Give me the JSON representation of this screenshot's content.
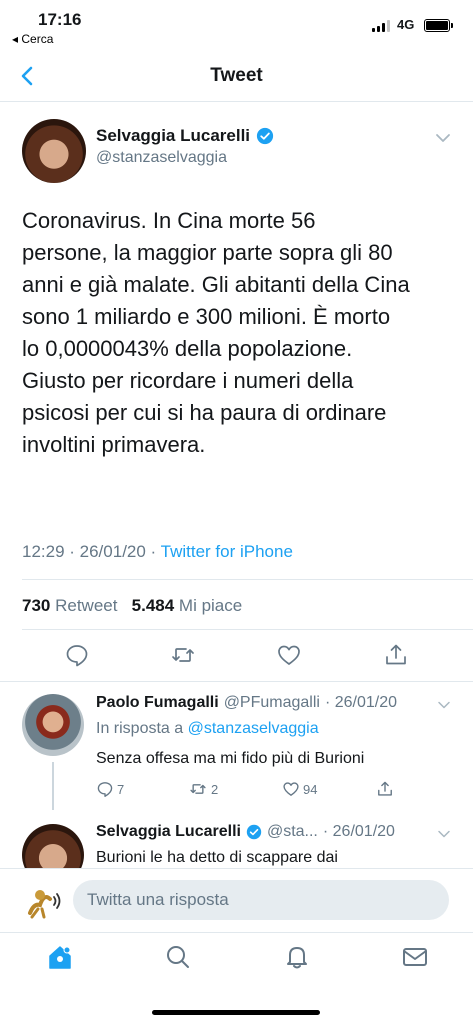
{
  "status_bar": {
    "time": "17:16",
    "back_app": "◂ Cerca",
    "network": "4G"
  },
  "nav": {
    "title": "Tweet",
    "back_icon": "chevron-left-icon"
  },
  "main_tweet": {
    "name": "Selvaggia Lucarelli",
    "handle": "@stanzaselvaggia",
    "text": "Coronavirus. In Cina morte 56\npersone, la maggior parte sopra gli 80\nanni e già malate. Gli abitanti della Cina\nsono 1 miliardo e 300 milioni. È morto\nlo 0,0000043% della popolazione.\nGiusto per ricordare i numeri della\npsicosi per cui si ha paura di ordinare\ninvoltini primavera.",
    "time": "12:29 · 26/01/20 · ",
    "source": "Twitter for iPhone",
    "retweets": "730",
    "retweets_label": " Retweet",
    "likes": "5.484",
    "likes_label": " Mi piace"
  },
  "replies": [
    {
      "name": "Paolo Fumagalli",
      "handle": "@PFumagalli",
      "date": "· 26/01/20",
      "reply_to_label": "In risposta a ",
      "reply_to": "@stanzaselvaggia",
      "text": "Senza offesa ma mi fido più di Burioni",
      "replies": "7",
      "retweets": "2",
      "likes": "94"
    },
    {
      "name": "Selvaggia Lucarelli",
      "handle": "@sta...",
      "date": "· 26/01/20",
      "text": "Burioni le ha detto di scappare dai"
    }
  ],
  "compose": {
    "placeholder": "Twitta una risposta"
  },
  "colors": {
    "accent": "#1da1f2",
    "muted": "#657786",
    "text": "#14171a"
  }
}
